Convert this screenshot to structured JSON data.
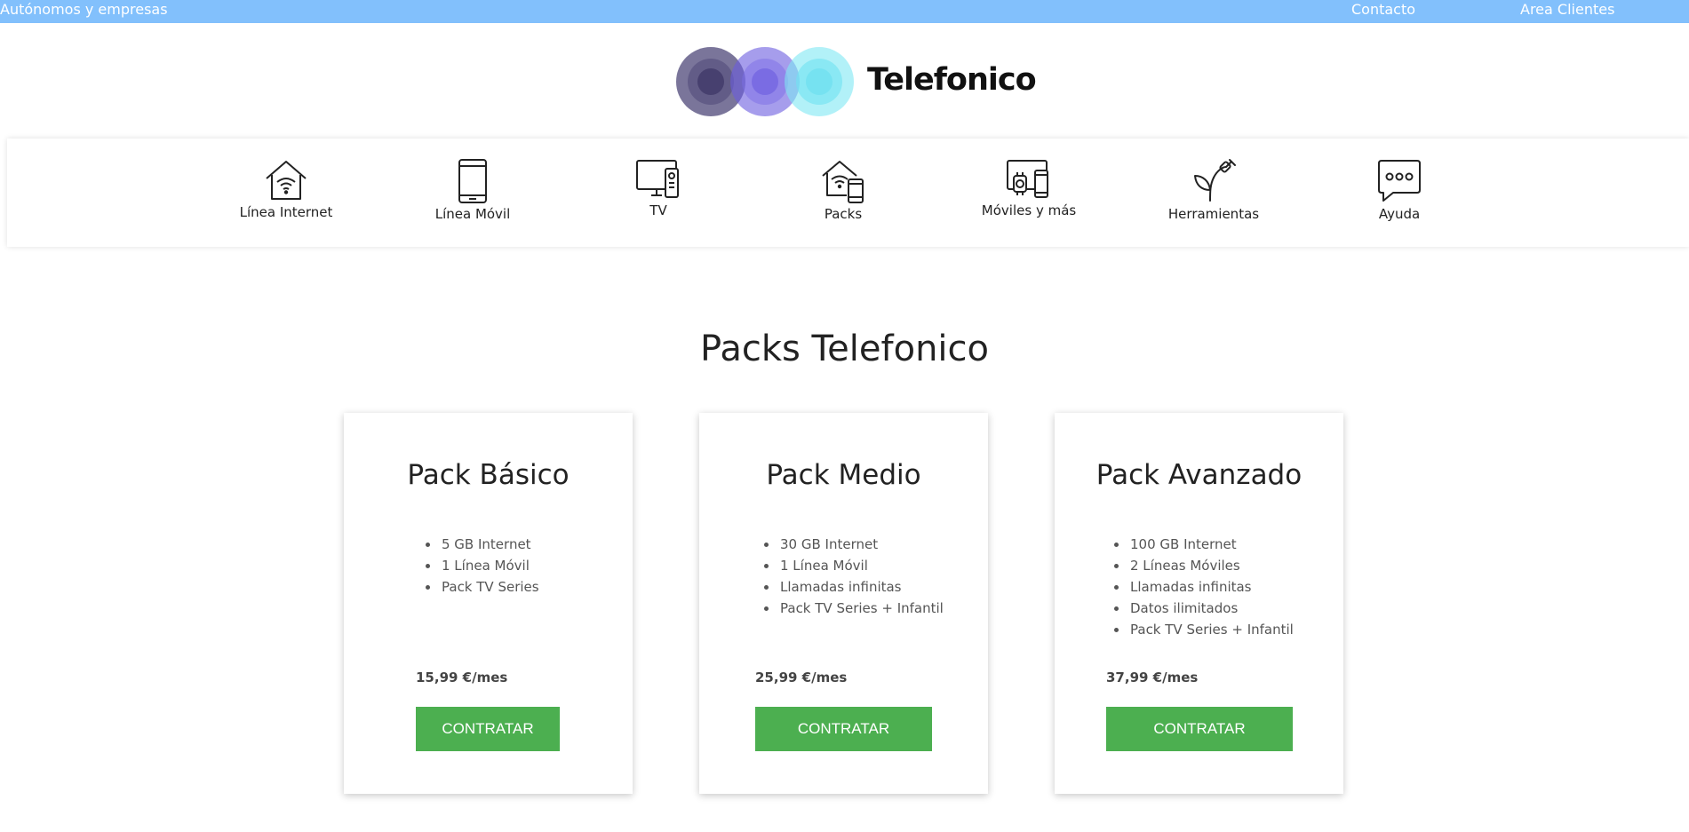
{
  "topbar": {
    "left_link": "Autónomos y empresas",
    "contact": "Contacto",
    "area": "Area Clientes",
    "color": "#82c0fc"
  },
  "logo": {
    "brand": "Telefonico"
  },
  "nav": [
    {
      "label": "Línea Internet",
      "icon": "house-wifi-icon"
    },
    {
      "label": "Línea Móvil",
      "icon": "smartphone-icon"
    },
    {
      "label": "TV",
      "icon": "tv-remote-icon"
    },
    {
      "label": "Packs",
      "icon": "house-phone-icon"
    },
    {
      "label": "Móviles y más",
      "icon": "devices-icon"
    },
    {
      "label": "Herramientas",
      "icon": "plant-plug-icon"
    },
    {
      "label": "Ayuda",
      "icon": "chat-bubble-icon"
    }
  ],
  "section_title": "Packs Telefonico",
  "cards": [
    {
      "title": "Pack Básico",
      "features": [
        "5 GB Internet",
        "1 Línea Móvil",
        "Pack TV Series"
      ],
      "price": "15,99 €/mes",
      "button": "CONTRATAR"
    },
    {
      "title": "Pack Medio",
      "features": [
        "30 GB Internet",
        "1 Línea Móvil",
        "Llamadas infinitas",
        "Pack TV Series + Infantil"
      ],
      "price": "25,99 €/mes",
      "button": "CONTRATAR"
    },
    {
      "title": "Pack Avanzado",
      "features": [
        "100 GB Internet",
        "2 Líneas Móviles",
        "Llamadas infinitas",
        "Datos ilimitados",
        "Pack TV Series + Infantil"
      ],
      "price": "37,99 €/mes",
      "button": "CONTRATAR"
    }
  ],
  "colors": {
    "button": "#4caf50",
    "text": "#222222"
  }
}
